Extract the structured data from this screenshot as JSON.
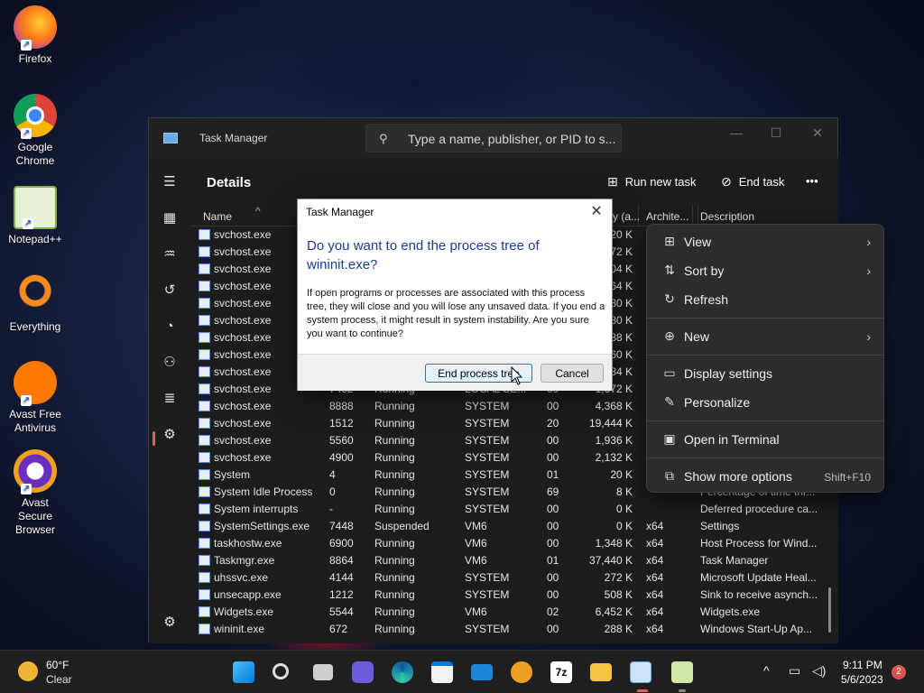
{
  "desktop": {
    "icons": [
      {
        "label": "Firefox",
        "icon": "firefox-icon"
      },
      {
        "label": "Google Chrome",
        "icon": "chrome-icon"
      },
      {
        "label": "Notepad++",
        "icon": "notepadpp-icon"
      },
      {
        "label": "Everything",
        "icon": "everything-icon"
      },
      {
        "label": "Avast Free Antivirus",
        "icon": "avast-icon"
      },
      {
        "label": "Avast Secure Browser",
        "icon": "avast-browser-icon"
      }
    ]
  },
  "window": {
    "title": "Task Manager",
    "search_placeholder": "Type a name, publisher, or PID to s...",
    "minimize": "—",
    "maximize": "☐",
    "close": "✕"
  },
  "header": {
    "title": "Details",
    "run_new_task": "Run new task",
    "end_task": "End task",
    "more": "•••"
  },
  "columns": {
    "name": "Name",
    "mem": "y (a...",
    "arch": "Archite...",
    "desc": "Description"
  },
  "rows": [
    {
      "name": "svchost.exe",
      "pid": "",
      "status": "",
      "user": "",
      "cpu": "",
      "mem": "20 K",
      "arch": "",
      "desc": ""
    },
    {
      "name": "svchost.exe",
      "pid": "",
      "status": "",
      "user": "",
      "cpu": "",
      "mem": "72 K",
      "arch": "",
      "desc": ""
    },
    {
      "name": "svchost.exe",
      "pid": "",
      "status": "",
      "user": "",
      "cpu": "",
      "mem": "04 K",
      "arch": "",
      "desc": ""
    },
    {
      "name": "svchost.exe",
      "pid": "",
      "status": "",
      "user": "",
      "cpu": "",
      "mem": "64 K",
      "arch": "",
      "desc": ""
    },
    {
      "name": "svchost.exe",
      "pid": "",
      "status": "",
      "user": "",
      "cpu": "",
      "mem": "80 K",
      "arch": "",
      "desc": ""
    },
    {
      "name": "svchost.exe",
      "pid": "",
      "status": "",
      "user": "",
      "cpu": "",
      "mem": "80 K",
      "arch": "",
      "desc": ""
    },
    {
      "name": "svchost.exe",
      "pid": "",
      "status": "",
      "user": "",
      "cpu": "",
      "mem": "88 K",
      "arch": "",
      "desc": ""
    },
    {
      "name": "svchost.exe",
      "pid": "",
      "status": "",
      "user": "",
      "cpu": "",
      "mem": "60 K",
      "arch": "",
      "desc": ""
    },
    {
      "name": "svchost.exe",
      "pid": "",
      "status": "",
      "user": "",
      "cpu": "",
      "mem": "84 K",
      "arch": "",
      "desc": ""
    },
    {
      "name": "svchost.exe",
      "pid": "7452",
      "status": "Running",
      "user": "LOCAL SE...",
      "cpu": "00",
      "mem": "1,672 K",
      "arch": "",
      "desc": ""
    },
    {
      "name": "svchost.exe",
      "pid": "8888",
      "status": "Running",
      "user": "SYSTEM",
      "cpu": "00",
      "mem": "4,368 K",
      "arch": "",
      "desc": ""
    },
    {
      "name": "svchost.exe",
      "pid": "1512",
      "status": "Running",
      "user": "SYSTEM",
      "cpu": "20",
      "mem": "19,444 K",
      "arch": "",
      "desc": ""
    },
    {
      "name": "svchost.exe",
      "pid": "5560",
      "status": "Running",
      "user": "SYSTEM",
      "cpu": "00",
      "mem": "1,936 K",
      "arch": "",
      "desc": ""
    },
    {
      "name": "svchost.exe",
      "pid": "4900",
      "status": "Running",
      "user": "SYSTEM",
      "cpu": "00",
      "mem": "2,132 K",
      "arch": "",
      "desc": ""
    },
    {
      "name": "System",
      "pid": "4",
      "status": "Running",
      "user": "SYSTEM",
      "cpu": "01",
      "mem": "20 K",
      "arch": "",
      "desc": ""
    },
    {
      "name": "System Idle Process",
      "pid": "0",
      "status": "Running",
      "user": "SYSTEM",
      "cpu": "69",
      "mem": "8 K",
      "arch": "",
      "desc": "Percentage of time thr..."
    },
    {
      "name": "System interrupts",
      "pid": "-",
      "status": "Running",
      "user": "SYSTEM",
      "cpu": "00",
      "mem": "0 K",
      "arch": "",
      "desc": "Deferred procedure ca..."
    },
    {
      "name": "SystemSettings.exe",
      "pid": "7448",
      "status": "Suspended",
      "user": "VM6",
      "cpu": "00",
      "mem": "0 K",
      "arch": "x64",
      "desc": "Settings"
    },
    {
      "name": "taskhostw.exe",
      "pid": "6900",
      "status": "Running",
      "user": "VM6",
      "cpu": "00",
      "mem": "1,348 K",
      "arch": "x64",
      "desc": "Host Process for Wind..."
    },
    {
      "name": "Taskmgr.exe",
      "pid": "8864",
      "status": "Running",
      "user": "VM6",
      "cpu": "01",
      "mem": "37,440 K",
      "arch": "x64",
      "desc": "Task Manager"
    },
    {
      "name": "uhssvc.exe",
      "pid": "4144",
      "status": "Running",
      "user": "SYSTEM",
      "cpu": "00",
      "mem": "272 K",
      "arch": "x64",
      "desc": "Microsoft Update Heal..."
    },
    {
      "name": "unsecapp.exe",
      "pid": "1212",
      "status": "Running",
      "user": "SYSTEM",
      "cpu": "00",
      "mem": "508 K",
      "arch": "x64",
      "desc": "Sink to receive asynch..."
    },
    {
      "name": "Widgets.exe",
      "pid": "5544",
      "status": "Running",
      "user": "VM6",
      "cpu": "02",
      "mem": "6,452 K",
      "arch": "x64",
      "desc": "Widgets.exe"
    },
    {
      "name": "wininit.exe",
      "pid": "672",
      "status": "Running",
      "user": "SYSTEM",
      "cpu": "00",
      "mem": "288 K",
      "arch": "x64",
      "desc": "Windows Start-Up Ap..."
    }
  ],
  "context_menu": {
    "view": "View",
    "sort_by": "Sort by",
    "refresh": "Refresh",
    "new": "New",
    "display_settings": "Display settings",
    "personalize": "Personalize",
    "open_terminal": "Open in Terminal",
    "show_more": "Show more options",
    "show_more_shortcut": "Shift+F10",
    "chevron": "›"
  },
  "dialog": {
    "title": "Task Manager",
    "heading": "Do you want to end the process tree of wininit.exe?",
    "body": "If open programs or processes are associated with this process tree, they will close and you will lose any unsaved data. If you end a system process, it might result in system instability. Are you sure you want to continue?",
    "confirm": "End process tree",
    "cancel": "Cancel",
    "close": "✕"
  },
  "taskbar": {
    "weather_temp": "60°F",
    "weather_cond": "Clear",
    "time": "9:11 PM",
    "date": "5/6/2023",
    "notification_count": "2",
    "apps": [
      "start-icon",
      "search-icon",
      "task-view-icon",
      "teams-chat-icon",
      "edge-icon",
      "store-icon",
      "mail-icon",
      "avast-browser-icon",
      "7zip-icon",
      "file-explorer-icon",
      "task-manager-icon",
      "notepadpp-icon"
    ],
    "seven_zip_label": "7z"
  },
  "colors": {
    "accent": "#0078d7",
    "heading_blue": "#1a3c8c",
    "window_bg": "#1c1c1c",
    "notification_red": "#d9534f"
  }
}
